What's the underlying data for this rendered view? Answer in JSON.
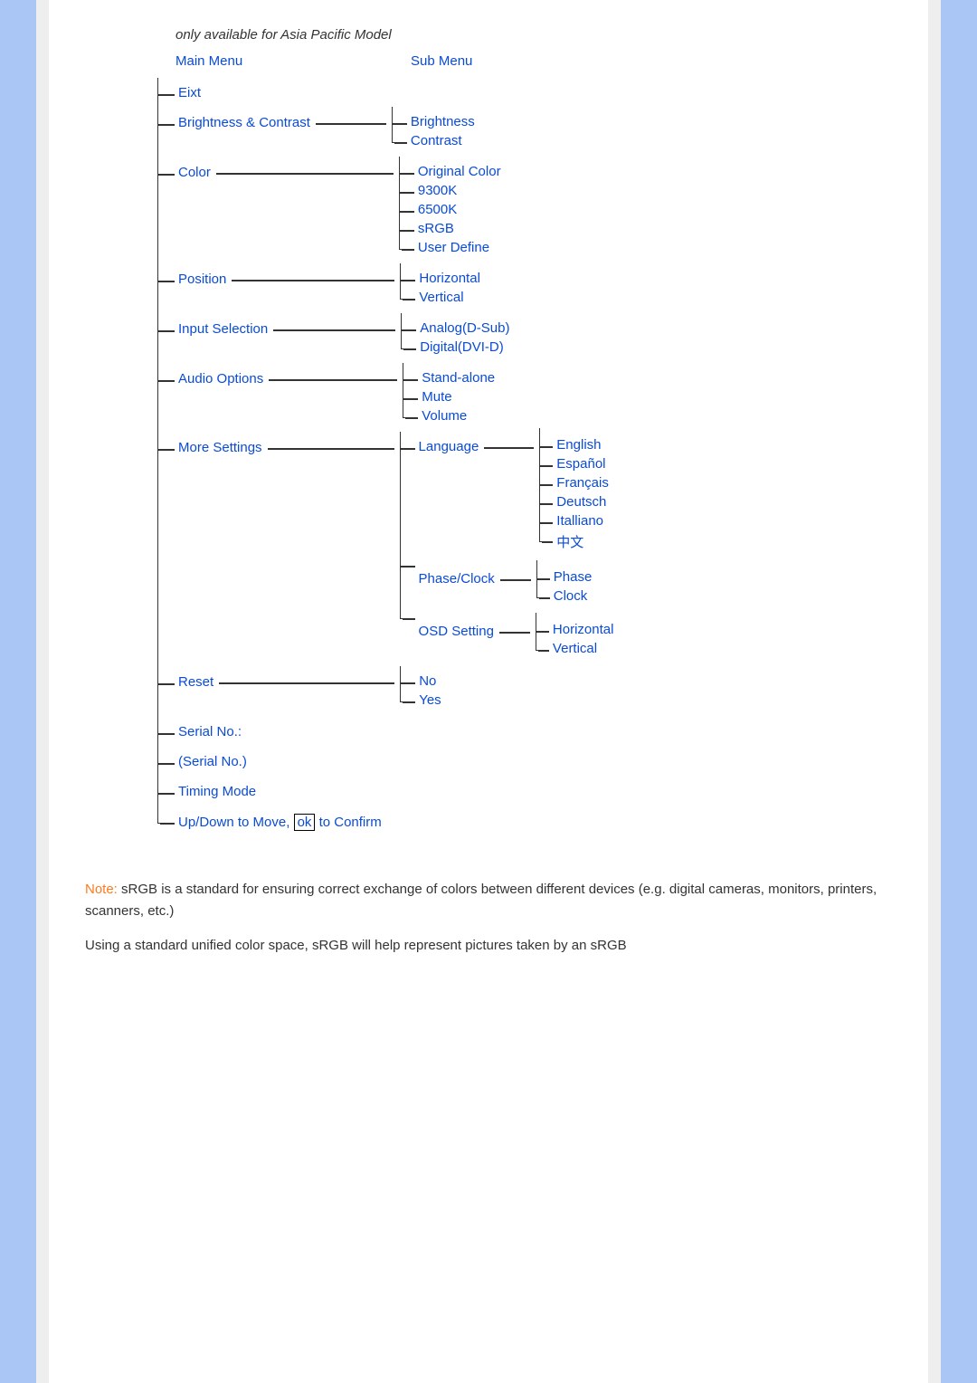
{
  "header_note": "only available for Asia Pacific Model",
  "columns": {
    "main": "Main Menu",
    "sub": "Sub Menu"
  },
  "menu": {
    "exit": "Eixt",
    "brightness_contrast": {
      "label": "Brightness & Contrast",
      "items": [
        "Brightness",
        "Contrast"
      ]
    },
    "color": {
      "label": "Color",
      "items": [
        "Original Color",
        "9300K",
        "6500K",
        "sRGB",
        "User Define"
      ]
    },
    "position": {
      "label": "Position",
      "items": [
        "Horizontal",
        "Vertical"
      ]
    },
    "input_selection": {
      "label": "Input Selection",
      "items": [
        "Analog(D-Sub)",
        "Digital(DVI-D)"
      ]
    },
    "audio_options": {
      "label": "Audio Options",
      "items": [
        "Stand-alone",
        "Mute",
        "Volume"
      ]
    },
    "more_settings": {
      "label": "More Settings",
      "language": {
        "label": "Language",
        "items": [
          "English",
          "Español",
          "Français",
          "Deutsch",
          "Italliano",
          "中文"
        ]
      },
      "phase_clock": {
        "label": "Phase/Clock",
        "items": [
          "Phase",
          "Clock"
        ]
      },
      "osd_setting": {
        "label": "OSD Setting",
        "items": [
          "Horizontal",
          "Vertical"
        ]
      }
    },
    "reset": {
      "label": "Reset",
      "items": [
        "No",
        "Yes"
      ]
    },
    "serial_no_label": "Serial No.:",
    "serial_no_value": "(Serial No.)",
    "timing_mode": "Timing Mode",
    "hint": {
      "pre": "Up/Down to Move, ",
      "ok": "ok",
      "post": " to Confirm"
    }
  },
  "note": {
    "lead": "Note:",
    "p1": "  sRGB is a standard for ensuring correct exchange of colors between different devices (e.g. digital cameras, monitors, printers, scanners, etc.)",
    "p2": "Using a standard unified color space, sRGB will help represent pictures taken by an sRGB"
  }
}
